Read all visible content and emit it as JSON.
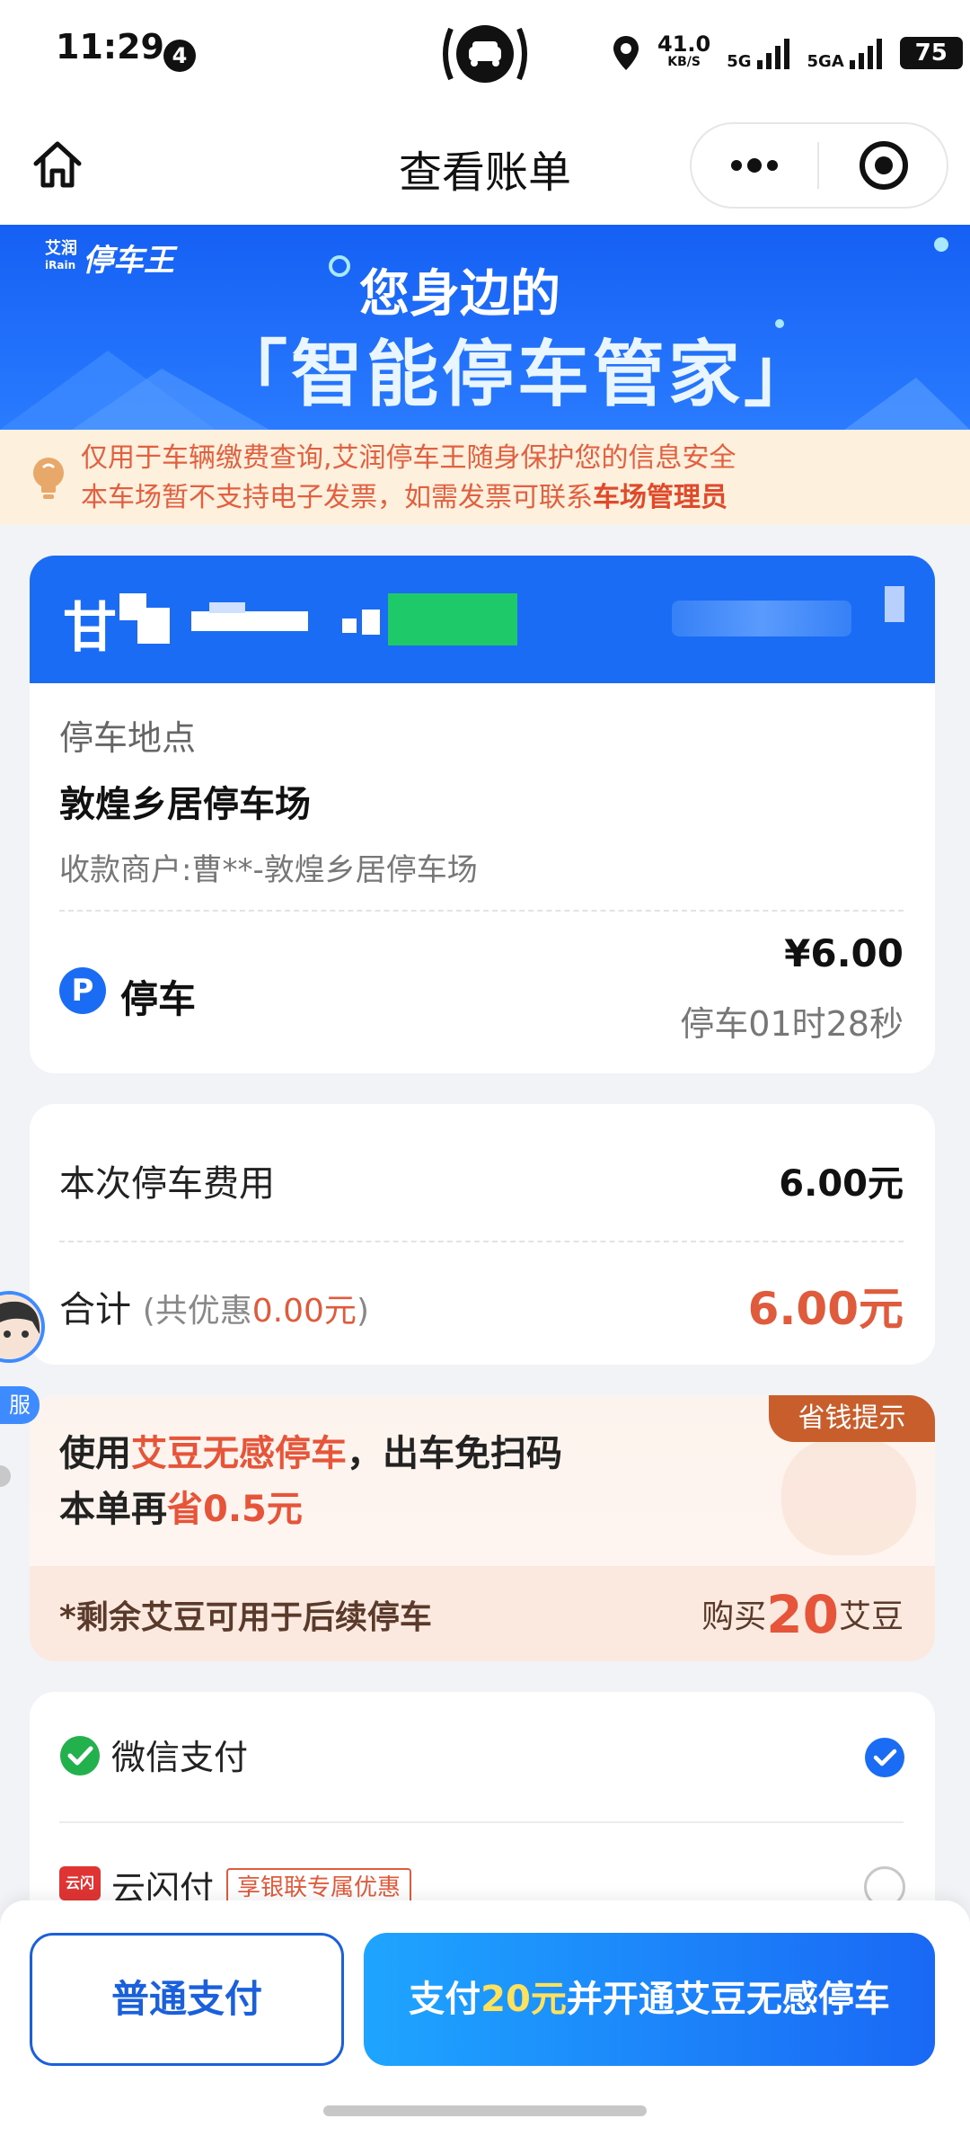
{
  "status_bar": {
    "time": "11:29",
    "notification_count": "4",
    "speed_value": "41.0",
    "speed_unit": "KB/S",
    "network_1": "5G",
    "network_2": "5GA",
    "battery": "75"
  },
  "nav": {
    "title": "查看账单"
  },
  "banner": {
    "brand_small_1": "艾润",
    "brand_small_2": "iRain",
    "brand_name": "停车王",
    "line1": "您身边的",
    "line2": "「智能停车管家」"
  },
  "notice": {
    "line1": "仅用于车辆缴费查询,艾润停车王随身保护您的信息安全",
    "line2_prefix": "本车场暂不支持电子发票，如需发票可联系",
    "line2_bold": "车场管理员"
  },
  "plate_card": {
    "plate_prefix": "甘",
    "location_label": "停车地点",
    "location_name": "敦煌乡居停车场",
    "merchant": "收款商户:曹**-敦煌乡居停车场",
    "item_icon": "P",
    "item_label": "停车",
    "price": "¥6.00",
    "duration": "停车01时28秒"
  },
  "fee_card": {
    "fee_label": "本次停车费用",
    "fee_value": "6.00元",
    "total_label": "合计",
    "discount_open": "(共优惠",
    "discount_value": "0.00元",
    "discount_close": ")",
    "total_value": "6.00元"
  },
  "side": {
    "service_label": "服"
  },
  "promo": {
    "tag": "省钱提示",
    "line1_a": "使用",
    "line1_hl": "艾豆无感停车",
    "line1_b": "，出车免扫码",
    "line2_a": "本单再",
    "line2_hl": "省0.5元",
    "note": "*剩余艾豆可用于后续停车",
    "buy_prefix": "购买",
    "buy_num": "20",
    "buy_suffix": "艾豆"
  },
  "payment": {
    "wechat_label": "微信支付",
    "yun_label": "云闪付",
    "yun_icon_text": "云闪付",
    "yun_tag": "享银联专属优惠",
    "selected": "wechat"
  },
  "actions": {
    "normal_pay": "普通支付",
    "primary_a": "支付",
    "primary_hl": "20元",
    "primary_b": "并开通艾豆无感停车"
  },
  "colors": {
    "brand_blue": "#1a6cf5",
    "accent_red": "#e05a3c",
    "promo_tag": "#c95e2d",
    "wechat_green": "#22b14c"
  }
}
